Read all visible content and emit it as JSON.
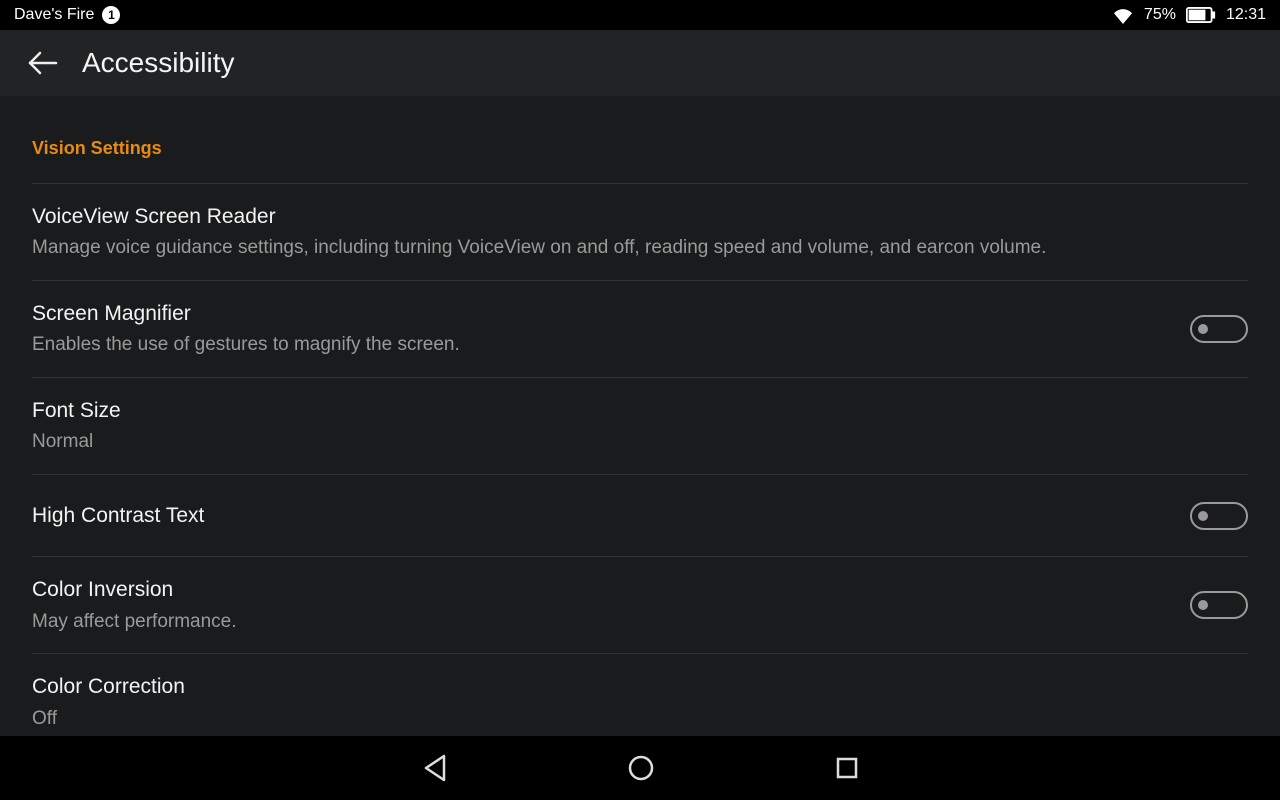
{
  "status": {
    "device_name": "Dave's Fire",
    "notification_count": "1",
    "battery_pct": "75%",
    "clock": "12:31"
  },
  "appbar": {
    "title": "Accessibility"
  },
  "section": {
    "header": "Vision Settings"
  },
  "rows": {
    "voiceview": {
      "title": "VoiceView Screen Reader",
      "sub": "Manage voice guidance settings, including turning VoiceView on and off, reading speed and volume, and earcon volume."
    },
    "magnifier": {
      "title": "Screen Magnifier",
      "sub": "Enables the use of gestures to magnify the screen."
    },
    "fontsize": {
      "title": "Font Size",
      "sub": "Normal"
    },
    "highcontrast": {
      "title": "High Contrast Text"
    },
    "colorinversion": {
      "title": "Color Inversion",
      "sub": "May affect performance."
    },
    "colorcorrection": {
      "title": "Color Correction",
      "sub": "Off"
    }
  }
}
